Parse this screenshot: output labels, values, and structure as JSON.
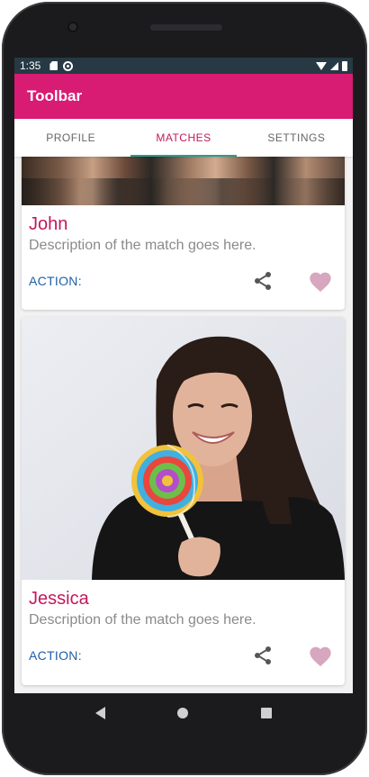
{
  "statusbar": {
    "time": "1:35",
    "icons": [
      "sd-card-icon",
      "sync-icon",
      "wifi-icon",
      "cell-signal-icon",
      "battery-icon"
    ]
  },
  "toolbar": {
    "title": "Toolbar"
  },
  "tabs": [
    {
      "label": "PROFILE",
      "active": false
    },
    {
      "label": "MATCHES",
      "active": true
    },
    {
      "label": "SETTINGS",
      "active": false
    }
  ],
  "cards": [
    {
      "name": "John",
      "description": "Description of the match goes here.",
      "action_label": "ACTION:"
    },
    {
      "name": "Jessica",
      "description": "Description of the match goes here.",
      "action_label": "ACTION:"
    }
  ],
  "colors": {
    "accent": "#d81b73",
    "name_text": "#c2185b",
    "action_text": "#1e5fa8",
    "tab_indicator": "#2a9d8f",
    "heart": "#d7a6bf",
    "status_bar": "#263944"
  },
  "navbar": {
    "icons": [
      "back-icon",
      "home-icon",
      "recent-apps-icon"
    ]
  }
}
